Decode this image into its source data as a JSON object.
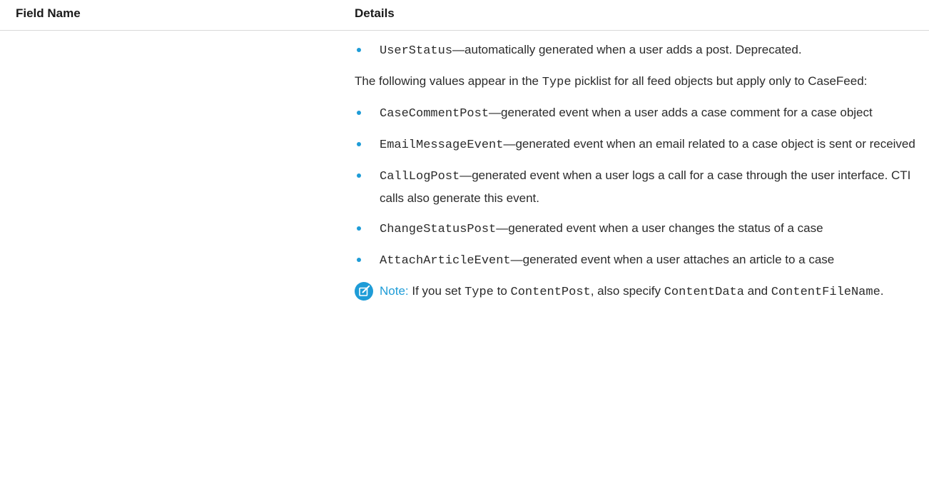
{
  "table": {
    "headers": {
      "field_name": "Field Name",
      "details": "Details"
    }
  },
  "details": {
    "user_status": {
      "code": "UserStatus",
      "text": "—automatically generated when a user adds a post. Deprecated."
    },
    "intro": {
      "pre": "The following values appear in the ",
      "code": "Type",
      "post": " picklist for all feed objects but apply only to CaseFeed:"
    },
    "case_items": [
      {
        "code": "CaseCommentPost",
        "text": "—generated event when a user adds a case comment for a case object"
      },
      {
        "code": "EmailMessageEvent",
        "text": "—generated event when an email related to a case object is sent or received"
      },
      {
        "code": "CallLogPost",
        "text": "—generated event when a user logs a call for a case through the user interface. CTI calls also generate this event."
      },
      {
        "code": "ChangeStatusPost",
        "text": "—generated event when a user changes the status of a case"
      },
      {
        "code": "AttachArticleEvent",
        "text": "—generated event when a user attaches an article to a case"
      }
    ],
    "note": {
      "label": "Note:",
      "t1": " If you set ",
      "c1": "Type",
      "t2": " to ",
      "c2": "ContentPost",
      "t3": ", also specify ",
      "c3": "ContentData",
      "t4": " and ",
      "c4": "ContentFileName",
      "t5": "."
    }
  },
  "colors": {
    "accent": "#1e9cd7",
    "divider": "#d9d9d9"
  },
  "icons": {
    "note": "note-edit-icon"
  }
}
